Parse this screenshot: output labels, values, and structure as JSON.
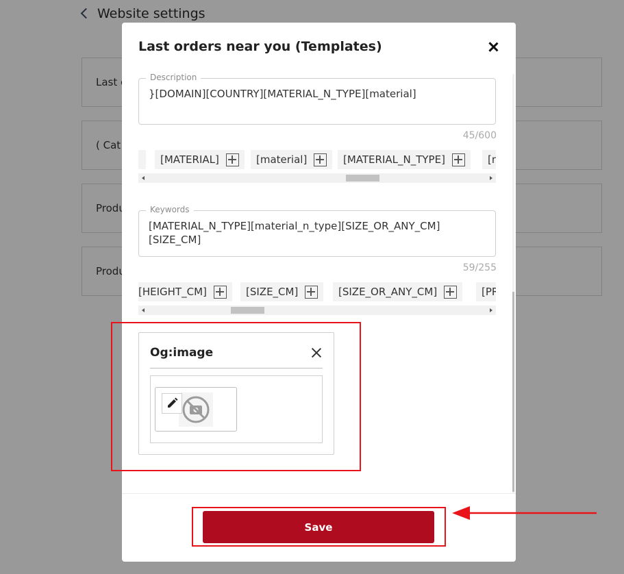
{
  "background": {
    "header_title": "Website settings",
    "cards": [
      "Last c",
      "( Cat",
      "Produ",
      "Produ"
    ]
  },
  "modal": {
    "title": "Last orders near you (Templates)",
    "description": {
      "legend": "Description",
      "value": "}[DOMAIN][COUNTRY][MATERIAL_N_TYPE][material]",
      "counter": "45/600",
      "chips": [
        "-",
        "[MATERIAL]",
        "[material]",
        "[MATERIAL_N_TYPE]",
        "[n"
      ]
    },
    "keywords": {
      "legend": "Keywords",
      "value": "[MATERIAL_N_TYPE][material_n_type][SIZE_OR_ANY_CM]\n[SIZE_CM]",
      "counter": "59/255",
      "chips": [
        "[HEIGHT_CM]",
        "[SIZE_CM]",
        "[SIZE_OR_ANY_CM]",
        "[PR"
      ]
    },
    "og_image": {
      "title": "Og:image"
    },
    "save_label": "Save"
  },
  "colors": {
    "accent": "#b00c20",
    "annotation": "#e8141a",
    "overlay": "rgba(0,0,0,0.4)"
  },
  "icons": [
    "chevron-left-icon",
    "close-icon",
    "plus-icon",
    "edit-pencil-icon",
    "no-image-icon",
    "arrow-left-icon"
  ]
}
